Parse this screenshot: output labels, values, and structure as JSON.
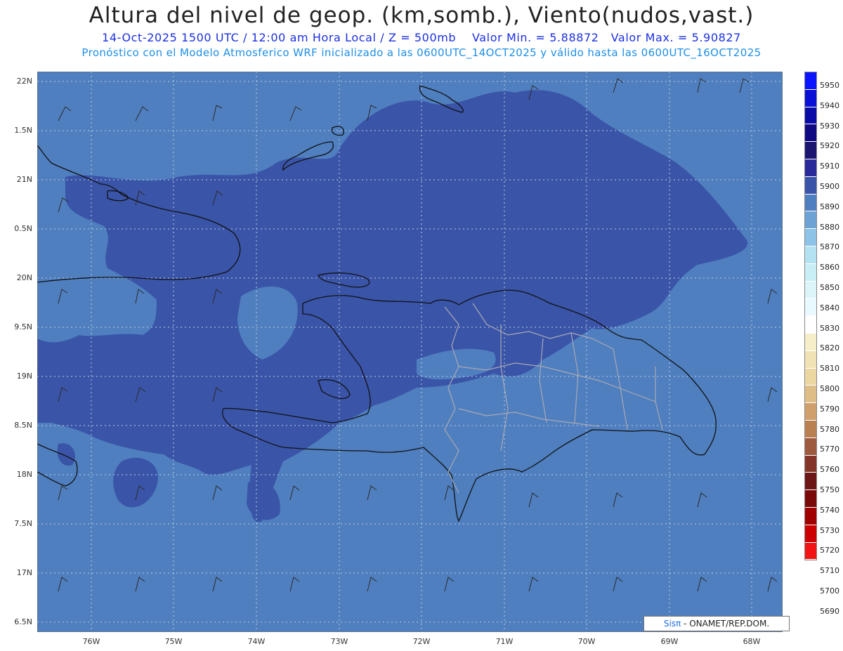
{
  "header": {
    "title": "Altura del nivel de geop. (km,somb.), Viento(nudos,vast.)",
    "subtitle_main": "14-Oct-2025  1500 UTC / 12:00 am Hora Local / Z = 500mb",
    "min_value": "Valor Min. = 5.88872",
    "max_value": "Valor Max. = 5.90827",
    "model_info": "Pronóstico con el Modelo Atmosferico WRF inicializado a las 0600UTC_14OCT2025 y válido hasta las  0600UTC_16OCT2025"
  },
  "axes": {
    "lat_labels": [
      "22N",
      "1.5N",
      "21N",
      "0.5N",
      "20N",
      "9.5N",
      "19N",
      "8.5N",
      "18N",
      "7.5N",
      "17N",
      "6.5N"
    ],
    "lon_labels": [
      "76W",
      "75W",
      "74W",
      "73W",
      "72W",
      "71W",
      "70W",
      "69W",
      "68W"
    ]
  },
  "colorbar": {
    "labels": [
      "5950",
      "5940",
      "5930",
      "5920",
      "5910",
      "5900",
      "5890",
      "5880",
      "5870",
      "5860",
      "5850",
      "5840",
      "5830",
      "5820",
      "5810",
      "5800",
      "5790",
      "5780",
      "5770",
      "5760",
      "5750",
      "5740",
      "5730",
      "5720",
      "5710",
      "5700",
      "5690"
    ],
    "colors": [
      "#0a14ff",
      "#0a10d6",
      "#0a0ca8",
      "#0f0a82",
      "#1a1670",
      "#2a2a9a",
      "#3a54a8",
      "#4f7fbf",
      "#6ea2d4",
      "#8cc3e6",
      "#b4e2f2",
      "#c8eef6",
      "#dbf5f9",
      "#e8faff",
      "#fff",
      "#f6eec8",
      "#f1e2b6",
      "#ecd6a2",
      "#dfbd86",
      "#cfa06c",
      "#b98152",
      "#9d5a3e",
      "#84352a",
      "#6c1616",
      "#7a0a0a",
      "#a00000",
      "#cc0000",
      "#f21414"
    ],
    "field_colors": {
      "high": "#3a54a8",
      "mid": "#4f7fbf"
    }
  },
  "credit": {
    "sis": "Sisπ",
    "text": " - ONAMET/REP.DOM."
  }
}
